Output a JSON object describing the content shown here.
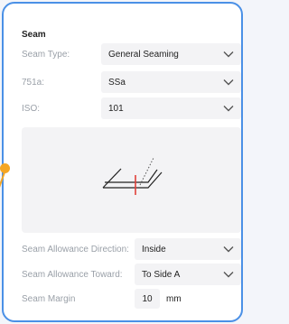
{
  "section": {
    "title": "Seam"
  },
  "fields": [
    {
      "label": "Seam Type:",
      "value": "General Seaming"
    },
    {
      "label": "751a:",
      "value": "SSa"
    },
    {
      "label": "ISO:",
      "value": "101"
    }
  ],
  "allowance": [
    {
      "label": "Seam Allowance Direction:",
      "value": "Inside"
    },
    {
      "label": "Seam Allowance Toward:",
      "value": "To Side A"
    }
  ],
  "margin": {
    "label": "Seam Margin",
    "value": "10",
    "unit": "mm"
  },
  "icons": {
    "dropdown": "chevron-down-icon",
    "preview": "seam-diagram"
  },
  "colors": {
    "accent": "#4a90e6",
    "handle": "#f5a623",
    "seam_mark": "#e0403a"
  }
}
